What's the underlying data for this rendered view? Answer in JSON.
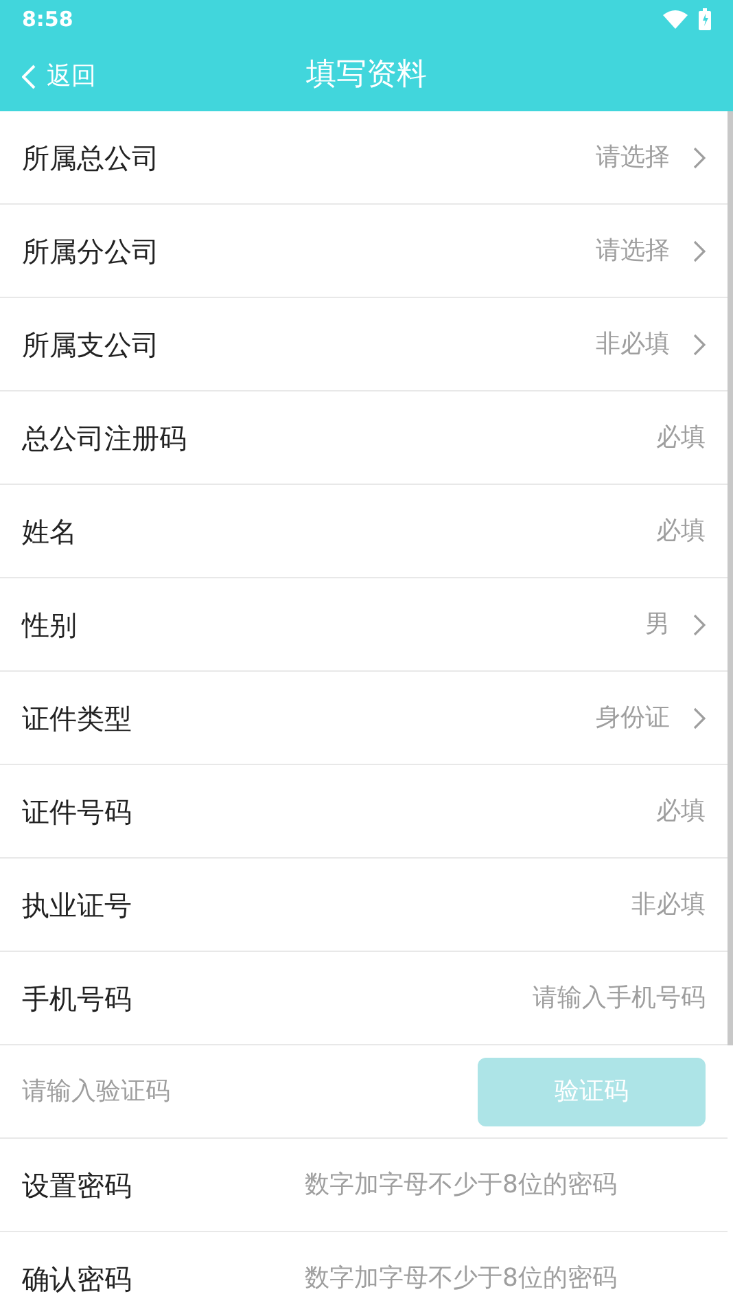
{
  "status_bar": {
    "time": "8:58"
  },
  "nav": {
    "back": "返回",
    "title": "填写资料"
  },
  "rows": [
    {
      "kind": "select",
      "label": "所属总公司",
      "value": "请选择"
    },
    {
      "kind": "select",
      "label": "所属分公司",
      "value": "请选择"
    },
    {
      "kind": "select",
      "label": "所属支公司",
      "value": "非必填"
    },
    {
      "kind": "input",
      "label": "总公司注册码",
      "placeholder": "必填"
    },
    {
      "kind": "input",
      "label": "姓名",
      "placeholder": "必填"
    },
    {
      "kind": "select",
      "label": "性别",
      "value": "男"
    },
    {
      "kind": "select",
      "label": "证件类型",
      "value": "身份证"
    },
    {
      "kind": "input",
      "label": "证件号码",
      "placeholder": "必填"
    },
    {
      "kind": "input",
      "label": "执业证号",
      "placeholder": "非必填"
    },
    {
      "kind": "input",
      "label": "手机号码",
      "placeholder": "请输入手机号码"
    },
    {
      "kind": "code",
      "placeholder": "请输入验证码",
      "button": "验证码",
      "disabled": true
    },
    {
      "kind": "password",
      "label": "设置密码",
      "placeholder": "数字加字母不少于8位的密码"
    },
    {
      "kind": "password",
      "label": "确认密码",
      "placeholder": "数字加字母不少于8位的密码"
    }
  ]
}
